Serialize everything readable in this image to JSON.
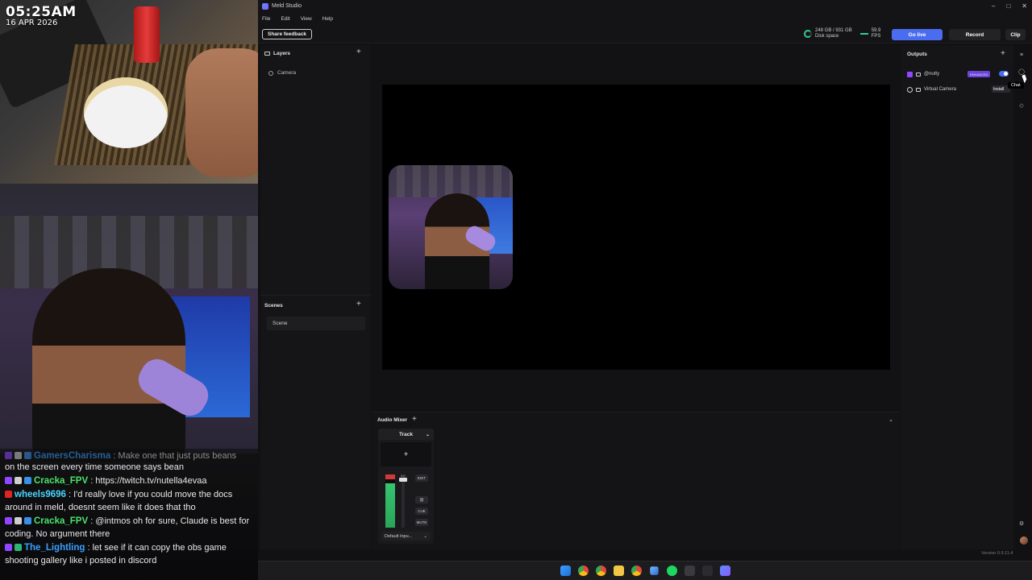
{
  "overlay": {
    "clock": "05:25AM",
    "date": "16 APR 2026",
    "chat": [
      {
        "user": "GamersCharisma",
        "text": ": Make one that just puts beans",
        "continuation": "on the screen every time someone says bean",
        "color": "#3aa0ff",
        "faded": true
      },
      {
        "user": "Cracka_FPV",
        "text": ": https://twitch.tv/nutella4evaa",
        "color": "#4be36a"
      },
      {
        "user": "wheels9696",
        "text": ": I'd really love if you could move the docs around in meld, doesnt seem like it does that tho",
        "color": "#4ad6ff"
      },
      {
        "user": "Cracka_FPV",
        "text": ": @intmos oh for sure, Claude is best for coding. No argument there",
        "color": "#4be36a"
      },
      {
        "user": "The_Lightling",
        "text": ": let see if it can copy the obs game shooting gallery like i posted in discord",
        "color": "#3aa0ff"
      }
    ]
  },
  "window": {
    "title": "Meld Studio",
    "controls": [
      "–",
      "□",
      "✕"
    ],
    "menu": [
      "File",
      "Edit",
      "View",
      "Help"
    ]
  },
  "toolbar": {
    "share_label": "Share feedback",
    "disk_value": "248 GB / 931 GB",
    "disk_label": "Disk space",
    "fps_value": "59.9",
    "fps_label": "FPS",
    "golive_label": "Go live",
    "record_label": "Record",
    "clip_label": "Clip"
  },
  "layers": {
    "title": "Layers",
    "items": [
      "Camera"
    ]
  },
  "scenes": {
    "title": "Scenes",
    "items": [
      "Scene"
    ]
  },
  "mixer": {
    "title": "Audio Mixer",
    "track_label": "Track",
    "db_value": "0.0",
    "edit_label": "EDIT",
    "cue_label": "CUE",
    "mute_label": "MUTE",
    "input_label": "Default Inpu..."
  },
  "outputs": {
    "title": "Outputs",
    "items": [
      {
        "name": "@nutty",
        "badge": "ENHANCED",
        "enabled": true
      },
      {
        "name": "Virtual Camera",
        "action": "Install"
      }
    ]
  },
  "rail": {
    "tooltip": "Chat"
  },
  "footer": {
    "version": "Version 0.9.11.4"
  },
  "colors": {
    "accent": "#4a6cf0",
    "twitch": "#9146ff",
    "meter_green": "#36c46d"
  }
}
